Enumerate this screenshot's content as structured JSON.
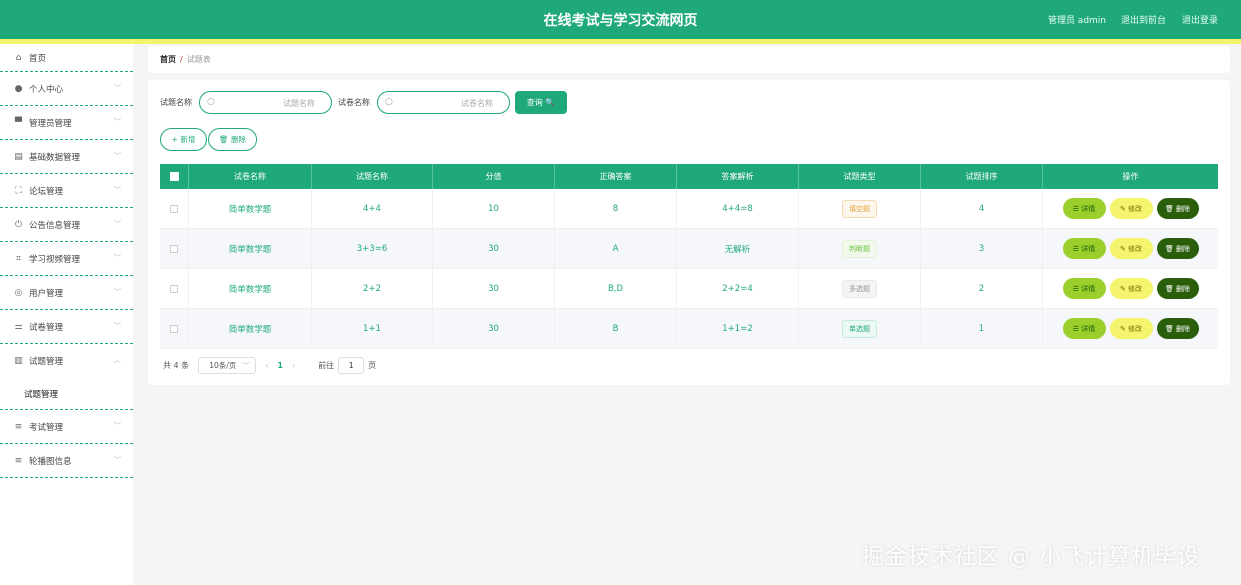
{
  "header": {
    "title": "在线考试与学习交流网页",
    "admin": "管理员 admin",
    "back": "退出到前台",
    "logout": "退出登录"
  },
  "sidebar": {
    "items": [
      {
        "label": "首页",
        "icon": "home-icon",
        "glyph": "⌂"
      },
      {
        "label": "个人中心",
        "icon": "user-icon",
        "glyph": "👤"
      },
      {
        "label": "管理员管理",
        "icon": "monitor-icon",
        "glyph": "▀"
      },
      {
        "label": "基础数据管理",
        "icon": "briefcase-icon",
        "glyph": "▤"
      },
      {
        "label": "论坛管理",
        "icon": "crop-icon",
        "glyph": "⛶"
      },
      {
        "label": "公告信息管理",
        "icon": "power-icon",
        "glyph": "⏻"
      },
      {
        "label": "学习视频管理",
        "icon": "crop-alt-icon",
        "glyph": "⌗"
      },
      {
        "label": "用户管理",
        "icon": "compass-icon",
        "glyph": "◎"
      },
      {
        "label": "试卷管理",
        "icon": "sliders-icon",
        "glyph": "⚌"
      },
      {
        "label": "试题管理",
        "icon": "bar-chart-icon",
        "glyph": "▥"
      },
      {
        "label": "考试管理",
        "icon": "list-icon",
        "glyph": "≡"
      },
      {
        "label": "轮播图信息",
        "icon": "list-icon",
        "glyph": "≡"
      }
    ],
    "submenu": "试题管理"
  },
  "breadcrumb": {
    "home": "首页",
    "sep": "/",
    "current": "试题表"
  },
  "search": {
    "label1": "试题名称",
    "placeholder1": "试题名称",
    "label2": "试卷名称",
    "placeholder2": "试卷名称",
    "query": "查询 🔍"
  },
  "actions": {
    "add": "+ 新增",
    "delete": "🗑 删除"
  },
  "table": {
    "headers": [
      "试卷名称",
      "试题名称",
      "分值",
      "正确答案",
      "答案解析",
      "试题类型",
      "试题排序",
      "操作"
    ],
    "rows": [
      {
        "paper": "简单数学题",
        "question": "4+4",
        "score": "10",
        "answer": "8",
        "analysis": "4+4=8",
        "type": "填空题",
        "order": "4"
      },
      {
        "paper": "简单数学题",
        "question": "3+3=6",
        "score": "30",
        "answer": "A",
        "analysis": "无解析",
        "type": "判断题",
        "order": "3"
      },
      {
        "paper": "简单数学题",
        "question": "2+2",
        "score": "30",
        "answer": "B,D",
        "analysis": "2+2=4",
        "type": "多选题",
        "order": "2"
      },
      {
        "paper": "简单数学题",
        "question": "1+1",
        "score": "30",
        "answer": "B",
        "analysis": "1+1=2",
        "type": "单选题",
        "order": "1"
      }
    ],
    "btn_detail": "☰ 详情",
    "btn_edit": "✎ 修改",
    "btn_delete": "🗑 删除"
  },
  "tag_colors": {
    "填空题": {
      "fg": "#e6a23c",
      "bg": "#fdf6ec",
      "border": "#f5dab1"
    },
    "判断题": {
      "fg": "#67c23a",
      "bg": "#f0f9eb",
      "border": "#e1f3d8"
    },
    "多选题": {
      "fg": "#909399",
      "bg": "#f4f4f5",
      "border": "#e9e9eb"
    },
    "单选题": {
      "fg": "#1fa97a",
      "bg": "#ecf8f3",
      "border": "#c5ebdd"
    }
  },
  "pager": {
    "total": "共 4 条",
    "size": "10条/页",
    "prev": "‹",
    "page": "1",
    "next": "›",
    "goto": "前往",
    "input": "1",
    "unit": "页"
  },
  "watermark": "掘金技术社区 @ 小飞计算机毕设",
  "colors": {
    "primary": "#1fa97a",
    "accent_yellow": "#f1f56c"
  }
}
